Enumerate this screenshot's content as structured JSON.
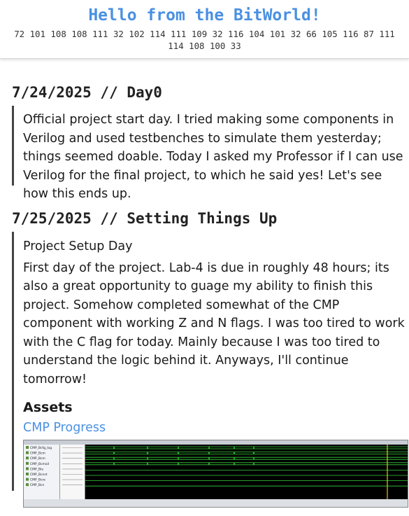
{
  "header": {
    "title": "Hello from the BitWorld!",
    "subtitle": "72 101 108 108 111 32 102 114 111 109 32 116 104 101 32 66 105 116 87 111 114 108 100 33"
  },
  "entries": [
    {
      "title": "7/24/2025 // Day0",
      "paragraph": "Official project start day. I tried making some components in Verilog and used testbenches to simulate them yesterday; things seemed doable. Today I asked my Professor if I can use Verilog for the final project, to which he said yes! Let's see how this ends up."
    },
    {
      "title": "7/25/2025 // Setting Things Up",
      "subheading": "Project Setup Day",
      "paragraph": "First day of the project. Lab-4 is due in roughly 48 hours; its also a great opportunity to guage my ability to finish this project. Somehow completed somewhat of the CMP component with working Z and N flags. I was too tired to work with the C flag for today. Mainly because I was too tired to understand the logic behind it. Anyways, I'll continue tomorrow!",
      "assets_heading": "Assets",
      "asset_link": "CMP Progress",
      "signals": [
        "CMP_Bcfg_log",
        "CMP_Bcm",
        "CMP_Bcm",
        "CMP_Bcmail",
        "CMP_Bie",
        "CMP_Bcnst",
        "CMP_Bcre",
        "CMP_Bcn"
      ]
    }
  ],
  "colors": {
    "title_blue": "#4a90e2",
    "link_blue": "#4a90e2",
    "wave_green": "#38d23c"
  }
}
